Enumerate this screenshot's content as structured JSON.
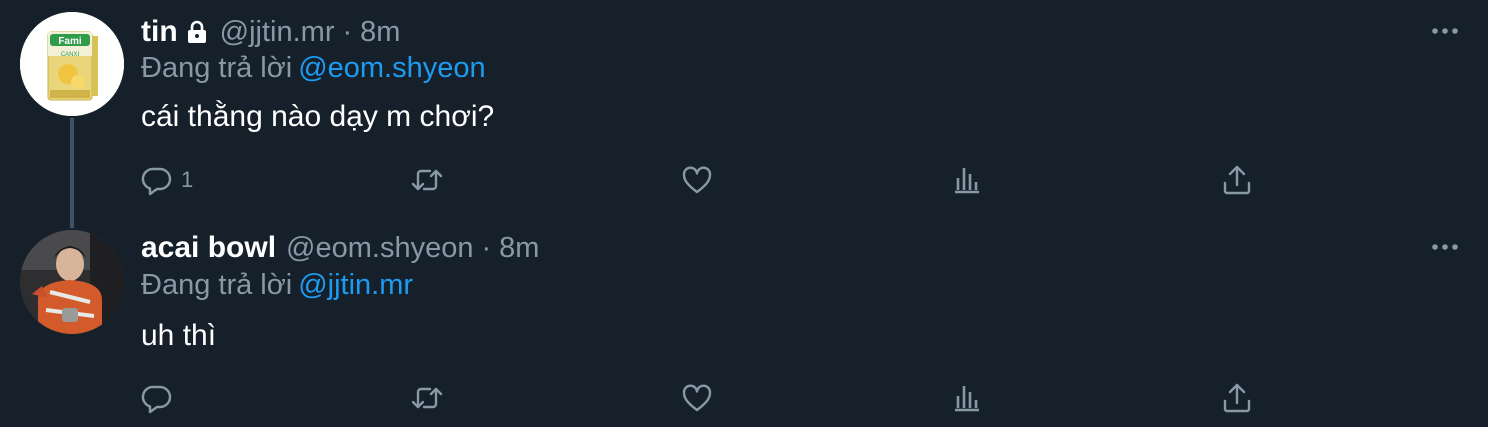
{
  "tweets": [
    {
      "display_name": "tin",
      "handle": "@jjtin.mr",
      "separator": "·",
      "time": "8m",
      "reply_prefix": "Đang trả lời",
      "reply_to": "@eom.shyeon",
      "text": "cái thằng nào dạy m chơi?",
      "reply_count": "1",
      "avatar_text": "Fami",
      "avatar_subtext": "CANXI",
      "protected": true,
      "icons": {
        "lock": "lock-icon",
        "more": "more-icon",
        "reply": "reply-icon",
        "retweet": "retweet-icon",
        "like": "heart-icon",
        "stats": "analytics-icon",
        "share": "share-icon"
      }
    },
    {
      "display_name": "acai bowl",
      "handle": "@eom.shyeon",
      "separator": "·",
      "time": "8m",
      "reply_prefix": "Đang trả lời",
      "reply_to": "@jjtin.mr",
      "text": "uh thì",
      "reply_count": "",
      "protected": false,
      "icons": {
        "more": "more-icon",
        "reply": "reply-icon",
        "retweet": "retweet-icon",
        "like": "heart-icon",
        "stats": "analytics-icon",
        "share": "share-icon"
      }
    }
  ],
  "colors": {
    "background": "#15202b",
    "primary_text": "#ffffff",
    "secondary_text": "#8899a6",
    "link": "#1d9bf0",
    "thread_line": "#3d5466"
  }
}
